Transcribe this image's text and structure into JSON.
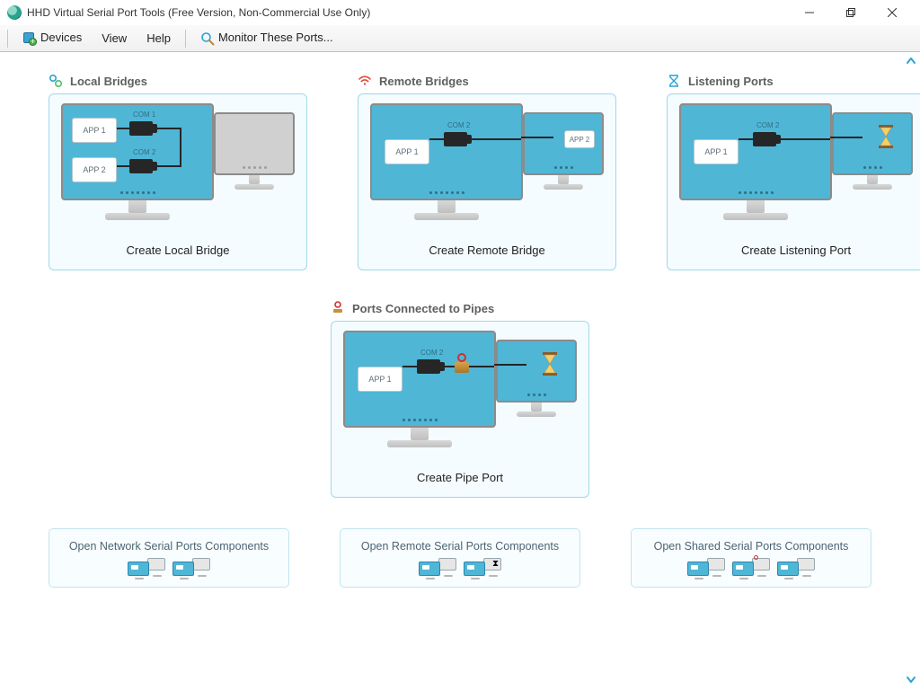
{
  "window": {
    "title": "HHD Virtual Serial Port Tools (Free Version, Non-Commercial Use Only)"
  },
  "menu": {
    "devices": "Devices",
    "view": "View",
    "help": "Help",
    "monitor": "Monitor These Ports..."
  },
  "sections": {
    "local": {
      "title": "Local Bridges",
      "action": "Create Local Bridge"
    },
    "remote": {
      "title": "Remote Bridges",
      "action": "Create Remote Bridge"
    },
    "listen": {
      "title": "Listening Ports",
      "action": "Create Listening Port"
    },
    "pipe": {
      "title": "Ports Connected to Pipes",
      "action": "Create Pipe Port"
    }
  },
  "labels": {
    "app1": "APP 1",
    "app2": "APP 2",
    "com1": "COM 1",
    "com2": "COM 2"
  },
  "components": {
    "network": "Open Network Serial Ports Components",
    "remote": "Open Remote Serial Ports Components",
    "shared": "Open Shared Serial Ports Components"
  }
}
